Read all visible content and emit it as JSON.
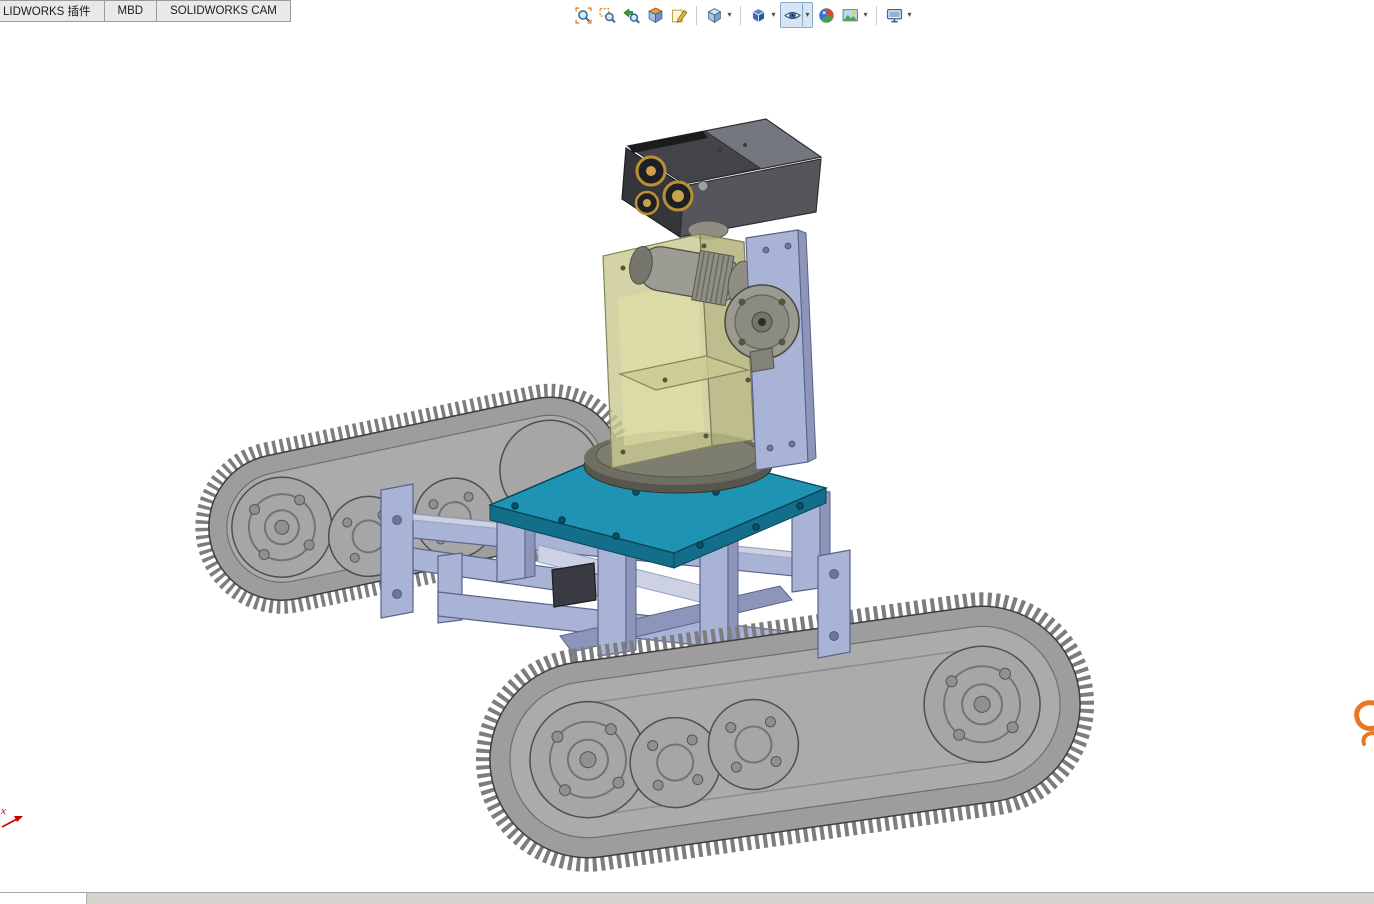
{
  "tabs": [
    {
      "label": "LIDWORKS 插件"
    },
    {
      "label": "MBD"
    },
    {
      "label": "SOLIDWORKS CAM"
    }
  ],
  "toolbar": {
    "dropdown_glyph": "▾",
    "items": [
      {
        "name": "zoom-to-fit",
        "dropdown": false,
        "pressed": false
      },
      {
        "name": "zoom-to-area",
        "dropdown": false,
        "pressed": false
      },
      {
        "name": "previous-view",
        "dropdown": false,
        "pressed": false
      },
      {
        "name": "section-view",
        "dropdown": false,
        "pressed": false
      },
      {
        "name": "dynamic-annotation-views",
        "dropdown": false,
        "pressed": false
      },
      {
        "name": "view-orientation",
        "dropdown": true,
        "pressed": false
      },
      {
        "name": "display-style",
        "dropdown": true,
        "pressed": false
      },
      {
        "name": "hide-show-items",
        "dropdown": true,
        "pressed": true
      },
      {
        "name": "edit-appearance",
        "dropdown": false,
        "pressed": false
      },
      {
        "name": "apply-scene",
        "dropdown": true,
        "pressed": false
      },
      {
        "name": "view-settings",
        "dropdown": true,
        "pressed": false
      }
    ]
  },
  "viewport": {
    "axis_triad": {
      "x_label": "x"
    }
  },
  "colors": {
    "accent_plate": "#1e93b4",
    "plate_side": "#136e8a",
    "chassis": "#a9b3d6",
    "chassis_dark": "#8d96ba",
    "chassis_edge": "#5a628a",
    "track_body": "#9d9d9d",
    "track_teeth": "#7d7d7d",
    "track_edge": "#3e3e3e",
    "track_inner": "#ababab",
    "head_top": "#74777d",
    "head_front": "#35363a",
    "head_side": "#54565c",
    "lens_gold": "#b99033",
    "olive": "#c9c993",
    "metal": "#9c9c94",
    "axis_x": "#cc0000",
    "brand_orange": "#e87722",
    "pressed_bg": "#d6e6f5",
    "pressed_border": "#8aa8c8",
    "tab_bg": "#e9e9e7",
    "tab_border": "#9b9b9b",
    "statusbar_bg": "#d6d3ce"
  }
}
